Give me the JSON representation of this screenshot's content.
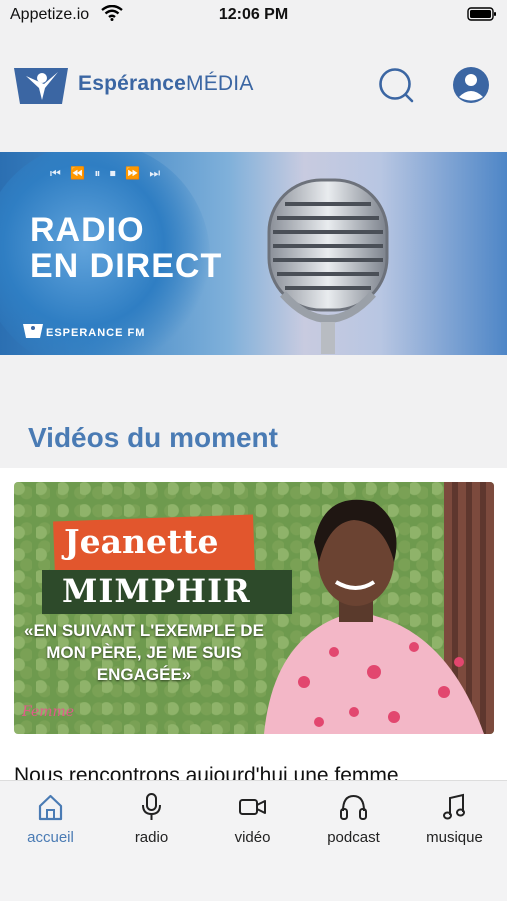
{
  "status_bar": {
    "carrier": "Appetize.io",
    "time": "12:06 PM"
  },
  "header": {
    "brand_primary": "Espérance",
    "brand_secondary": "MÉDIA"
  },
  "banner": {
    "title_line1": "RADIO",
    "title_line2": "EN DIRECT",
    "station": "ESPERANCE FM",
    "controls": "⏮ ⏪ ⏸ ⏹ ⏩ ⏭"
  },
  "section": {
    "title": "Vidéos du moment"
  },
  "video": {
    "thumb_name_first": "Jeanette",
    "thumb_name_last": "MIMPHIR",
    "thumb_quote": "«EN SUIVANT L'EXEMPLE DE MON PÈRE, JE ME SUIS ENGAGÉE»",
    "thumb_signature": "Femme",
    "description": "Nous rencontrons aujourd'hui une femme"
  },
  "tabs": [
    {
      "label": "accueil",
      "icon": "home-icon",
      "active": true
    },
    {
      "label": "radio",
      "icon": "microphone-icon",
      "active": false
    },
    {
      "label": "vidéo",
      "icon": "video-camera-icon",
      "active": false
    },
    {
      "label": "podcast",
      "icon": "headphones-icon",
      "active": false
    },
    {
      "label": "musique",
      "icon": "music-note-icon",
      "active": false
    }
  ],
  "colors": {
    "accent": "#4a7bb4",
    "brand": "#3b66a3",
    "banner_orange": "#e2562d"
  }
}
